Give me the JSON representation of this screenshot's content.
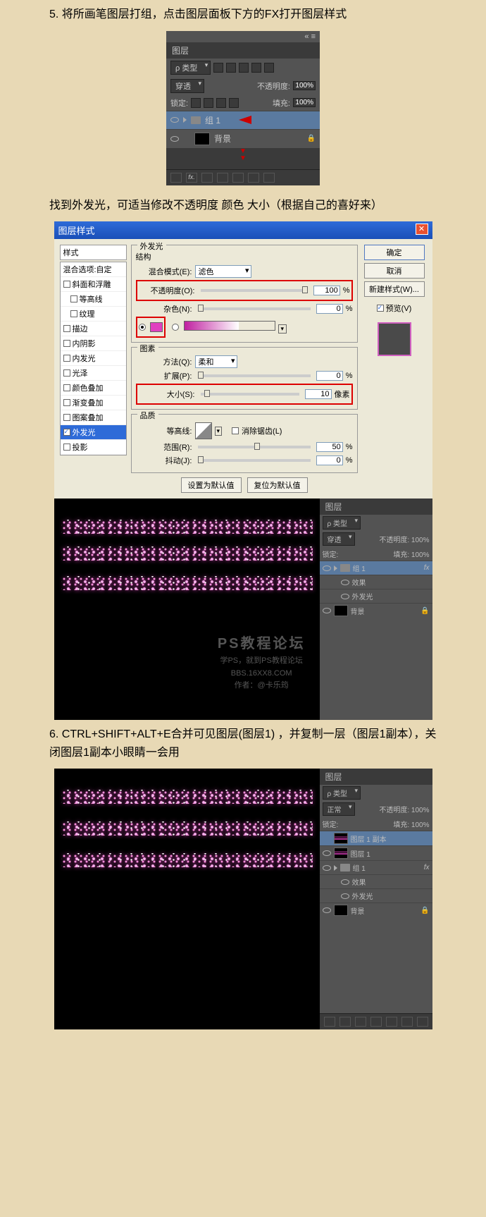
{
  "step5": "5. 将所画笔图层打组，点击图层面板下方的FX打开图层样式",
  "step5b": "找到外发光，可适当修改不透明度 颜色 大小（根据自己的喜好来）",
  "step6": "6. CTRL+SHIFT+ALT+E合并可见图层(图层1) ，并复制一层（图层1副本），关闭图层1副本小眼睛一会用",
  "layersPanel": {
    "title": "图层",
    "kindLabel": "ρ 类型",
    "blendMode": "穿透",
    "opacityLabel": "不透明度:",
    "opacityVal": "100%",
    "lockLabel": "锁定:",
    "fillLabel": "填充:",
    "fillVal": "100%",
    "group1": "组 1",
    "background": "背景",
    "fxLabel": "fx."
  },
  "dialog": {
    "title": "图层样式",
    "styles": {
      "header": "样式",
      "blendOpt": "混合选项:自定",
      "items": [
        "斜面和浮雕",
        "等高线",
        "纹理",
        "描边",
        "内阴影",
        "内发光",
        "光泽",
        "颜色叠加",
        "渐变叠加",
        "图案叠加",
        "外发光",
        "投影"
      ]
    },
    "outerGlow": {
      "title": "外发光",
      "structure": "结构",
      "blendModeLabel": "混合模式(E):",
      "blendModeVal": "滤色",
      "opacityLabel": "不透明度(O):",
      "opacityVal": "100",
      "noiseLabel": "杂色(N):",
      "noiseVal": "0",
      "elements": "图素",
      "techniqueLabel": "方法(Q):",
      "techniqueVal": "柔和",
      "spreadLabel": "扩展(P):",
      "spreadVal": "0",
      "sizeLabel": "大小(S):",
      "sizeVal": "10",
      "sizeUnit": "像素",
      "quality": "品质",
      "contourLabel": "等高线:",
      "antiAlias": "消除锯齿(L)",
      "rangeLabel": "范围(R):",
      "rangeVal": "50",
      "jitterLabel": "抖动(J):",
      "jitterVal": "0",
      "pct": "%",
      "setDefault": "设置为默认值",
      "resetDefault": "复位为默认值"
    },
    "buttons": {
      "ok": "确定",
      "cancel": "取消",
      "newStyle": "新建样式(W)...",
      "preview": "预览(V)"
    }
  },
  "watermark": {
    "title": "PS教程论坛",
    "sub1": "学PS，就到PS教程论坛",
    "sub2": "BBS.16XX8.COM",
    "sub3": "作者：@卡乐筠"
  },
  "sidePanel": {
    "passthrough": "穿透",
    "normal": "正常",
    "opacity": "不透明度: 100%",
    "lock": "锁定:",
    "fill": "填充: 100%",
    "group1": "组 1",
    "effects": "效果",
    "outerGlow": "外发光",
    "background": "背景",
    "layer1copy": "图层 1 副本",
    "layer1": "图层 1",
    "fx": "fx"
  }
}
